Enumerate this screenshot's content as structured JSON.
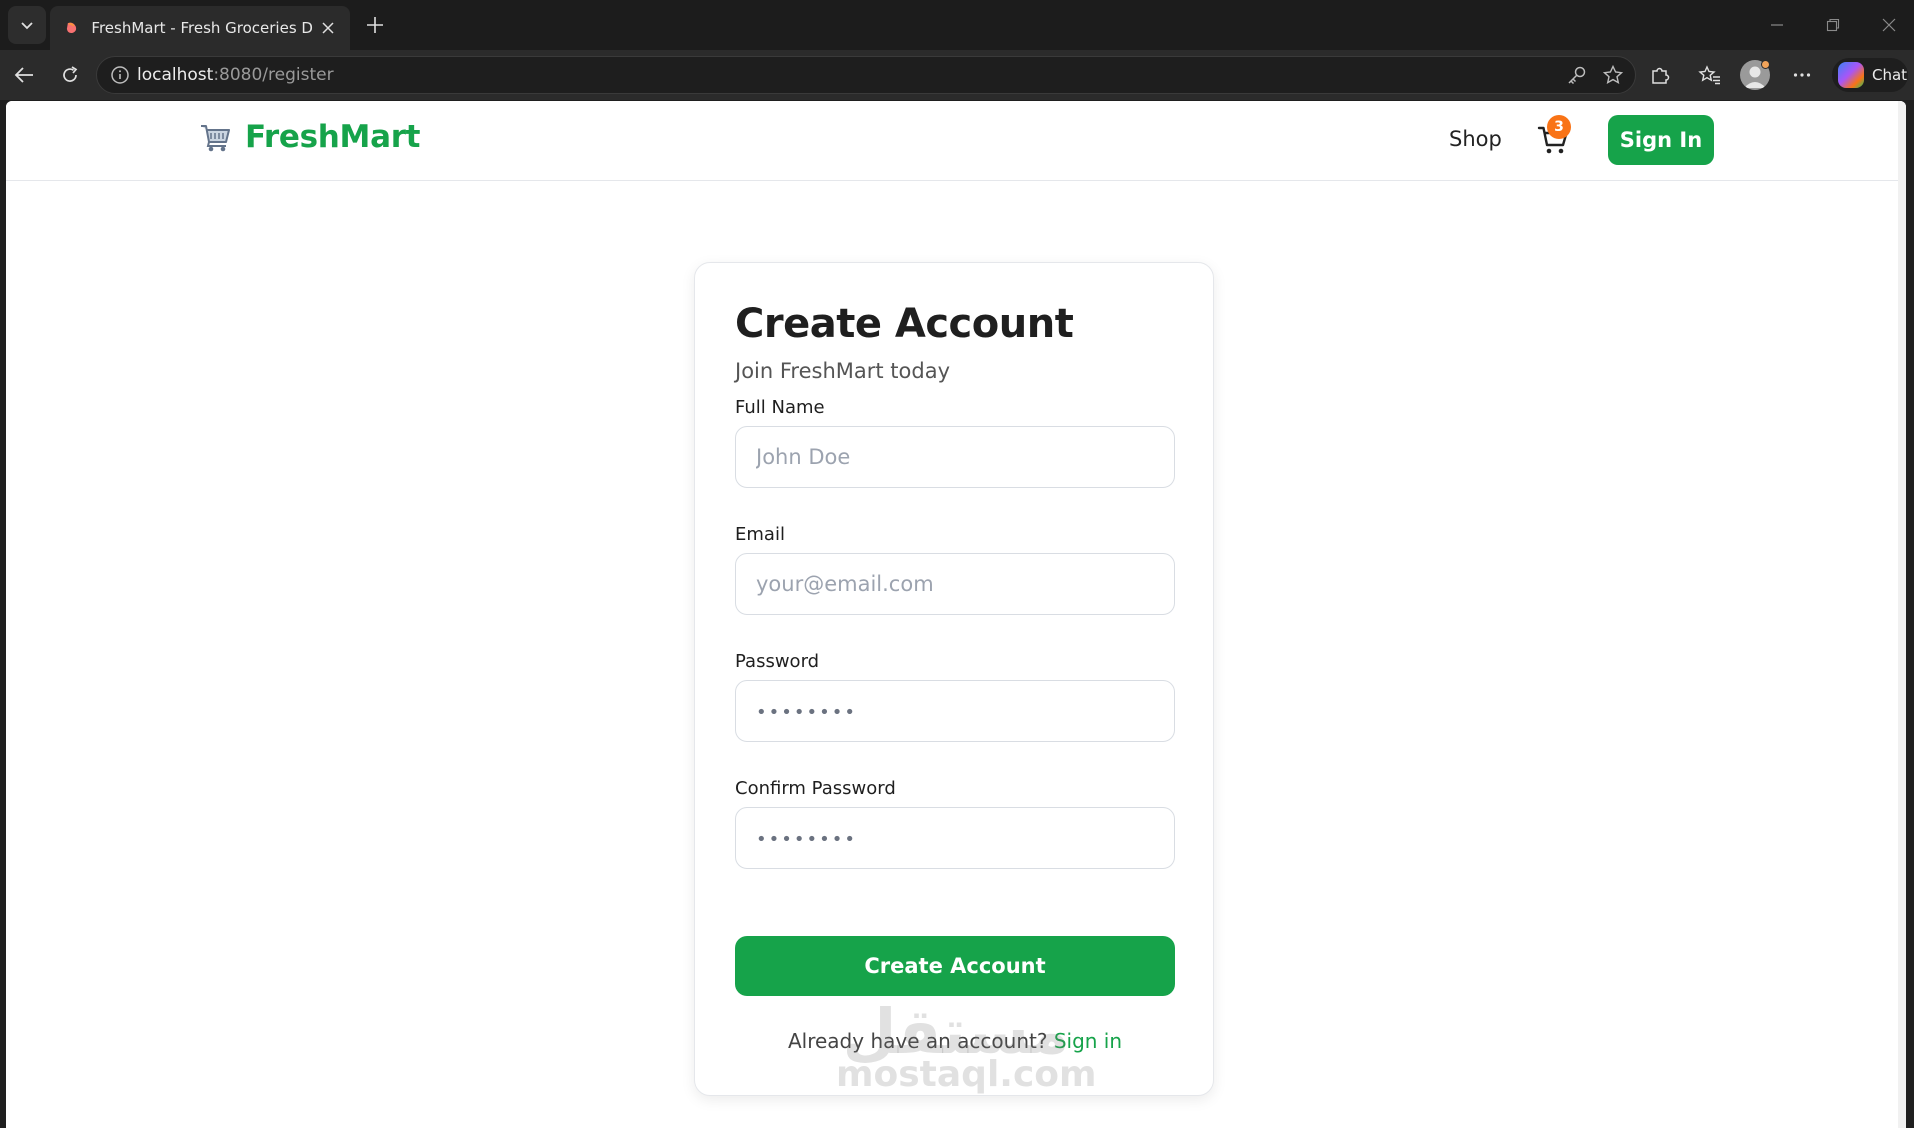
{
  "browser": {
    "tab_title": "FreshMart - Fresh Groceries Delivered",
    "url_host": "localhost",
    "url_rest": ":8080/register",
    "chat_label": "Chat"
  },
  "nav": {
    "brand": "FreshMart",
    "shop": "Shop",
    "cart_count": "3",
    "sign_in": "Sign In"
  },
  "form": {
    "title": "Create Account",
    "subtitle": "Join FreshMart today",
    "fields": [
      {
        "label": "Full Name",
        "placeholder": "John Doe",
        "value": ""
      },
      {
        "label": "Email",
        "placeholder": "your@email.com",
        "value": ""
      },
      {
        "label": "Password",
        "placeholder": "••••••••",
        "value": ""
      },
      {
        "label": "Confirm Password",
        "placeholder": "••••••••",
        "value": ""
      }
    ],
    "submit": "Create Account",
    "footer_text": "Already have an account?",
    "footer_link": "Sign in"
  },
  "watermark": {
    "arabic": "مستقل",
    "latin": "mostaql.com"
  },
  "colors": {
    "brand_green": "#16a34a",
    "badge_orange": "#f97316",
    "chrome_dark": "#1c1c1c"
  }
}
